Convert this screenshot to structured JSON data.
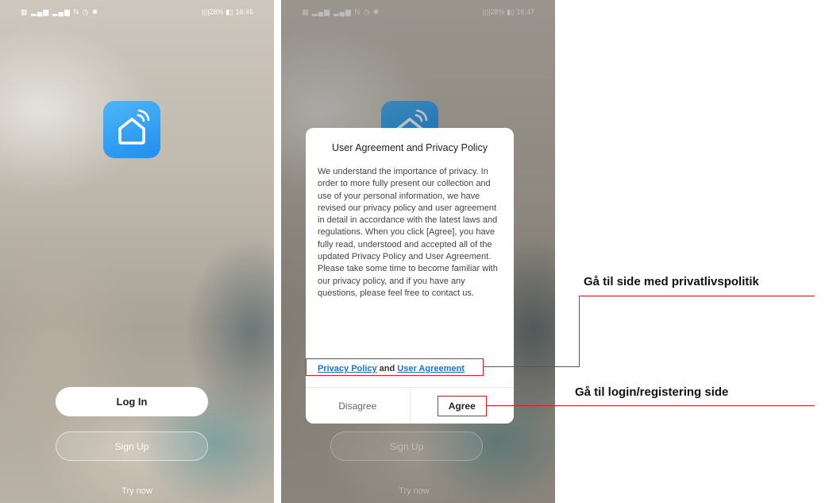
{
  "left_screen": {
    "status_left": "▦ ▂▄▆ ▂▄▆ N ◷ ✱",
    "status_right": "|▯|28% ▮▯ 16:46",
    "login_label": "Log In",
    "signup_label": "Sign Up",
    "try_now_label": "Try now"
  },
  "right_screen": {
    "status_left": "▦ ▂▄▆ ▂▄▆ N ◷ ✱",
    "status_right": "|▯|28% ▮▯ 16:47",
    "signup_label": "Sign Up",
    "try_now_label": "Try now",
    "dialog": {
      "title": "User Agreement and Privacy Policy",
      "body": "We understand the importance of privacy. In order to more fully present our collection and use of your personal information, we have revised our privacy policy and user agreement in detail in accordance with the latest laws and regulations. When you click [Agree], you have fully read, understood and accepted all of the updated Privacy Policy and User Agreement. Please take some time to become familiar with our privacy policy, and if you have any questions, please feel free to contact us.",
      "privacy_policy_link": "Privacy Policy",
      "and_text": "and",
      "user_agreement_link": "User Agreement",
      "disagree_label": "Disagree",
      "agree_label": "Agree"
    }
  },
  "annotations": {
    "privacy_note": "Gå til side med privatlivspolitik",
    "login_note": "Gå til login/registering side"
  },
  "colors": {
    "app_icon_blue": "#2196f3",
    "link_blue": "#1a73d9",
    "annotation_red": "#d0232a"
  },
  "icons": {
    "app_icon": "smart-home-icon"
  }
}
